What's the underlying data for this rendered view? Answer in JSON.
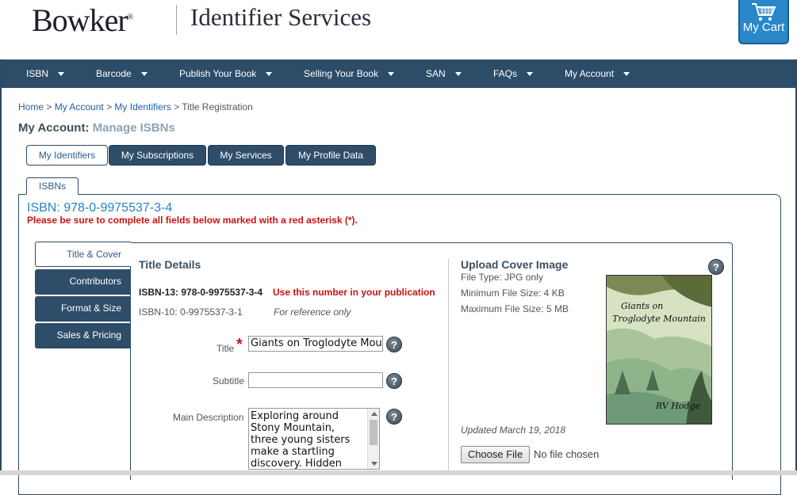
{
  "header": {
    "logo": "Bowker",
    "tagline": "Identifier Services",
    "cart_label": "My Cart"
  },
  "nav": {
    "items": [
      {
        "label": "ISBN"
      },
      {
        "label": "Barcode"
      },
      {
        "label": "Publish Your Book"
      },
      {
        "label": "Selling Your Book"
      },
      {
        "label": "SAN"
      },
      {
        "label": "FAQs"
      },
      {
        "label": "My Account"
      }
    ]
  },
  "breadcrumb": {
    "home": "Home",
    "sep": " > ",
    "account": "My Account",
    "identifiers": "My Identifiers",
    "current": "Title Registration"
  },
  "page": {
    "title": "My Account:",
    "subtitle": "Manage ISBNs"
  },
  "account_tabs": [
    {
      "label": "My Identifiers"
    },
    {
      "label": "My Subscriptions"
    },
    {
      "label": "My Services"
    },
    {
      "label": "My Profile Data"
    }
  ],
  "isbn_tab": "ISBNs",
  "isbn_heading": "ISBN: 978-0-9975537-3-4",
  "warning": "Please be sure to complete all fields below marked with a red asterisk (*).",
  "side_tabs": [
    {
      "label": "Title & Cover"
    },
    {
      "label": "Contributors"
    },
    {
      "label": "Format & Size"
    },
    {
      "label": "Sales & Pricing"
    }
  ],
  "title_details": {
    "heading": "Title Details",
    "isbn13": "ISBN-13: 978-0-9975537-3-4",
    "isbn13_note": "Use this number in your publication",
    "isbn10": "ISBN-10: 0-9975537-3-1",
    "isbn10_note": "For reference only",
    "title_label": "Title",
    "required_mark": "*",
    "title_value": "Giants on Troglodyte Mountain",
    "subtitle_label": "Subtitle",
    "subtitle_value": "",
    "desc_label": "Main Description",
    "desc_value": "Exploring around Stony Mountain, three young sisters make a startling discovery. Hidden away in the mountain"
  },
  "cover": {
    "heading": "Upload Cover Image",
    "file_type": "File Type: JPG only",
    "min_size": "Minimum File Size: 4 KB",
    "max_size": "Maximum File Size: 5 MB",
    "book_title_line1": "Giants on",
    "book_title_line2": "Troglodyte Mountain",
    "book_author": "RV Hodge",
    "updated": "Updated March 19, 2018",
    "choose_button": "Choose File",
    "no_file": "No file chosen"
  },
  "help_glyph": "?",
  "icons": [
    "cart-icon",
    "caret-down-icon",
    "help-icon"
  ]
}
